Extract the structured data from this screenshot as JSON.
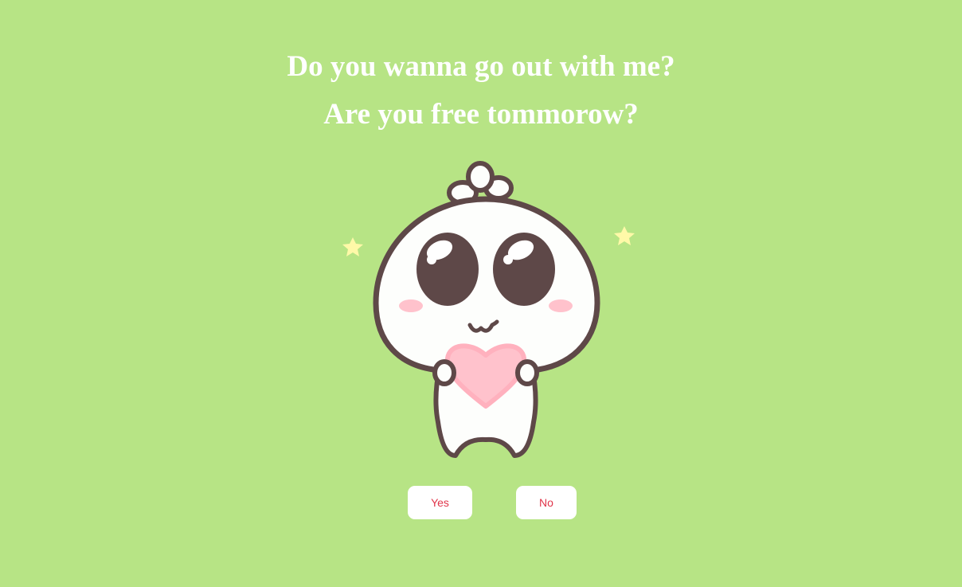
{
  "heading": {
    "line1": "Do you wanna go out with me?",
    "line2": "Are you free tommorow?"
  },
  "illustration": {
    "icon": "cute-mascot-holding-heart-icon"
  },
  "buttons": {
    "yes_label": "Yes",
    "no_label": "No"
  },
  "colors": {
    "background": "#b7e485",
    "heading_text": "#ffffff",
    "button_bg": "#ffffff",
    "button_text": "#e0354a",
    "heart": "#ffc2cc",
    "outline": "#5e4848"
  }
}
